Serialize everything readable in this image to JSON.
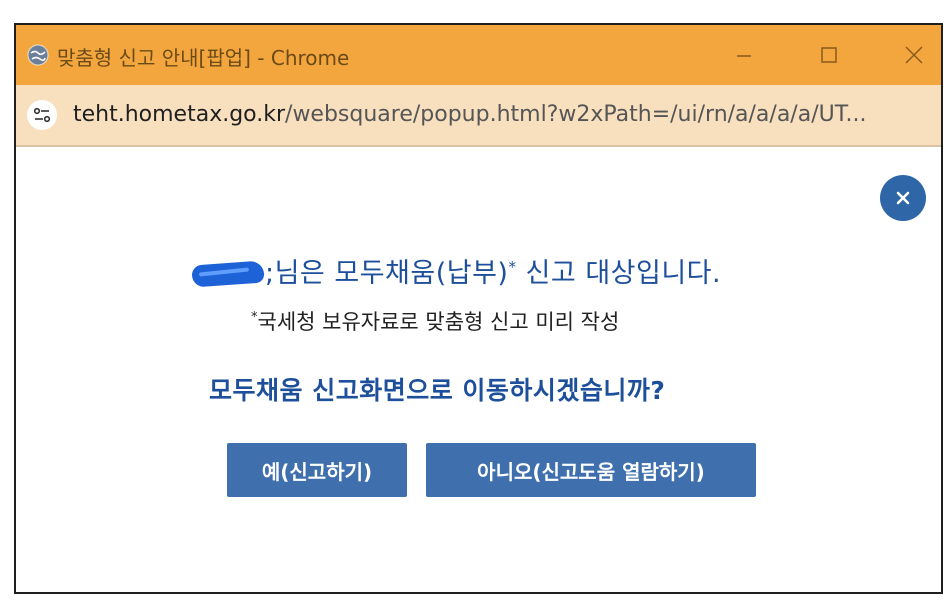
{
  "window": {
    "title": "맞춤형 신고 안내[팝업] - Chrome",
    "title_icon": "globe-icon",
    "controls": [
      "minimize-icon",
      "maximize-icon",
      "close-icon"
    ]
  },
  "address_bar": {
    "site_info_icon": "tune-icon",
    "url_host": "teht.hometax.go.kr",
    "url_path": "/websquare/popup.html?w2xPath=/ui/rn/a/a/a/a/UT..."
  },
  "dialog": {
    "close_icon": "close-icon",
    "headline_suffix": ";님은 모두채움(납부)",
    "headline_star": "*",
    "headline_tail": " 신고 대상입니다.",
    "note_star": "*",
    "note": "국세청 보유자료로 맞춤형 신고 미리 작성",
    "question": "모두채움 신고화면으로 이동하시겠습니까?",
    "yes_label": "예(신고하기)",
    "no_label": "아니오(신고도움 열람하기)"
  },
  "colors": {
    "titlebar": "#f3a63d",
    "addressbar": "#f8e0bf",
    "accent": "#1d4f9a",
    "button": "#3f6fad"
  }
}
